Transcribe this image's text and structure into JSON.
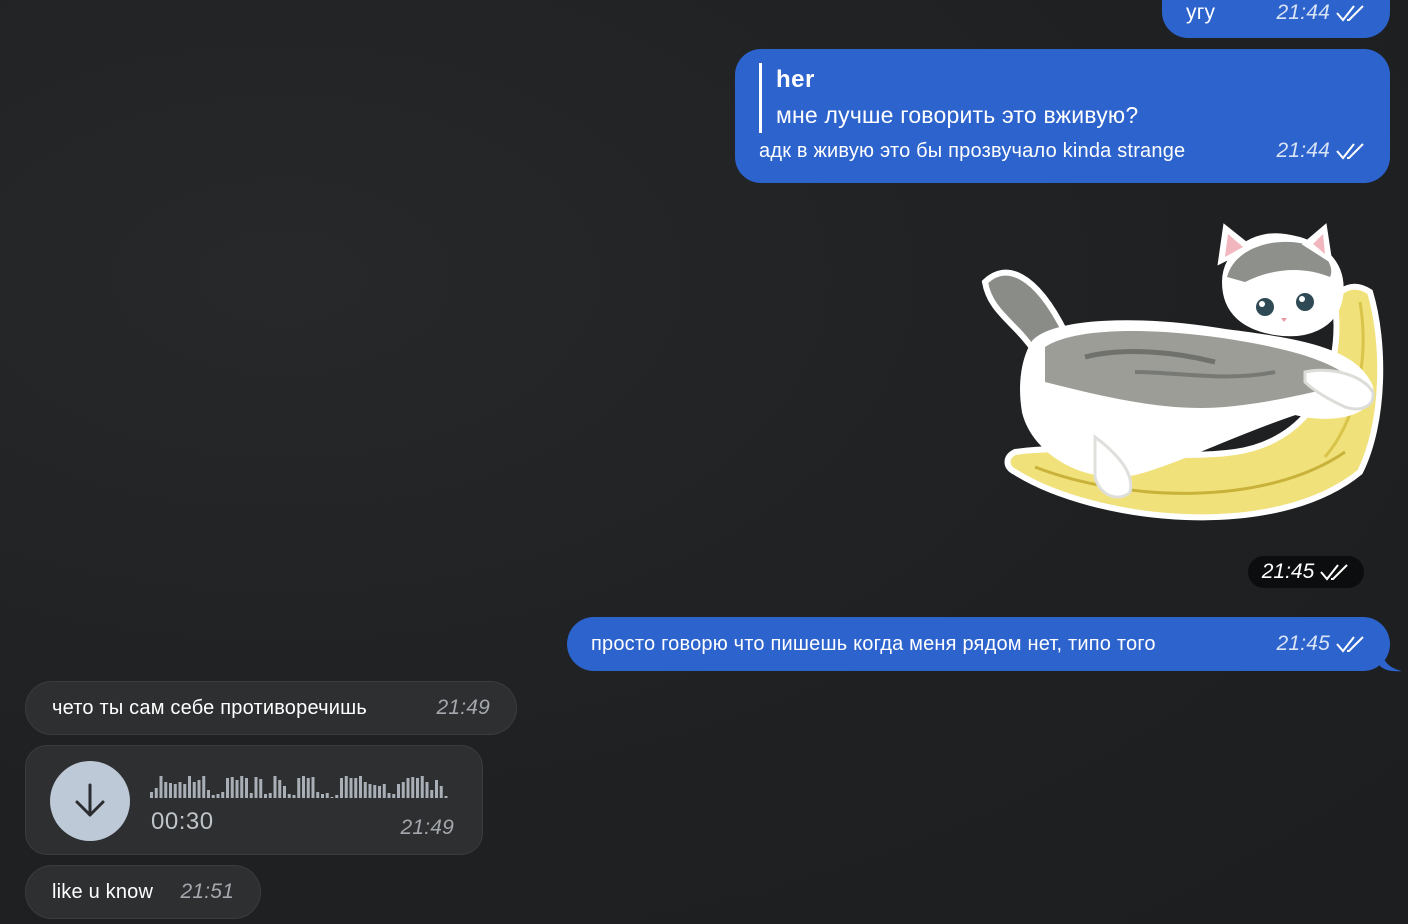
{
  "messages": {
    "m1": {
      "text": "угу",
      "time": "21:44",
      "status": "read"
    },
    "m2": {
      "reply_author": "her",
      "reply_text": "мне лучше говорить это вживую?",
      "text": "адк в живую это бы прозвучало kinda strange",
      "time": "21:44",
      "status": "read"
    },
    "m3": {
      "type": "sticker",
      "sticker": "cat-on-banana-sticker",
      "time": "21:45",
      "status": "read"
    },
    "m4": {
      "text": "просто говорю что пишешь когда меня рядом нет, типо того",
      "time": "21:45",
      "status": "read"
    },
    "m5": {
      "text": "чето ты сам себе противоречишь",
      "time": "21:49"
    },
    "m6": {
      "type": "voice",
      "duration": "00:30",
      "time": "21:49",
      "icon": "download-arrow-icon"
    },
    "m7": {
      "text": "like u know",
      "time": "21:51"
    }
  },
  "colors": {
    "outgoing_bubble": "#2c63cc",
    "incoming_bubble": "#2d2f31",
    "background": "#222426",
    "voice_button": "#bec9d8"
  }
}
